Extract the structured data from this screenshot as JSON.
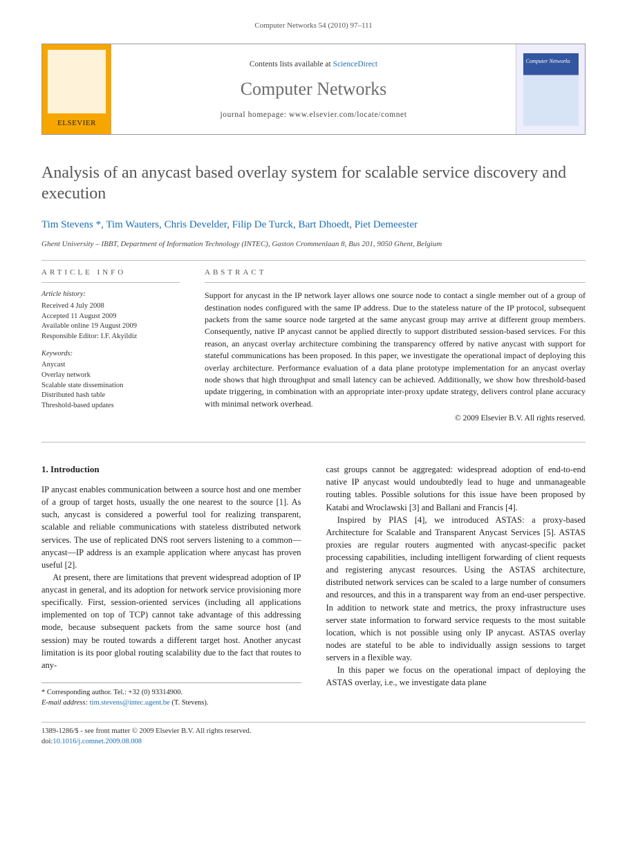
{
  "citation": "Computer Networks 54 (2010) 97–111",
  "header": {
    "contents_prefix": "Contents lists available at ",
    "contents_link": "ScienceDirect",
    "journal": "Computer Networks",
    "homepage_label": "journal homepage: www.elsevier.com/locate/comnet",
    "publisher_word": "ELSEVIER"
  },
  "title": "Analysis of an anycast based overlay system for scalable service discovery and execution",
  "authors_line": "Tim Stevens *, Tim Wauters, Chris Develder, Filip De Turck, Bart Dhoedt, Piet Demeester",
  "affiliation": "Ghent University – IBBT, Department of Information Technology (INTEC), Gaston Crommenlaan 8, Bus 201, 9050 Ghent, Belgium",
  "article_info": {
    "head": "article info",
    "history_label": "Article history:",
    "history": [
      "Received 4 July 2008",
      "Accepted 11 August 2009",
      "Available online 19 August 2009",
      "Responsible Editor: I.F. Akyildiz"
    ],
    "keywords_label": "Keywords:",
    "keywords": [
      "Anycast",
      "Overlay network",
      "Scalable state dissemination",
      "Distributed hash table",
      "Threshold-based updates"
    ]
  },
  "abstract": {
    "head": "abstract",
    "text": "Support for anycast in the IP network layer allows one source node to contact a single member out of a group of destination nodes configured with the same IP address. Due to the stateless nature of the IP protocol, subsequent packets from the same source node targeted at the same anycast group may arrive at different group members. Consequently, native IP anycast cannot be applied directly to support distributed session-based services. For this reason, an anycast overlay architecture combining the transparency offered by native anycast with support for stateful communications has been proposed. In this paper, we investigate the operational impact of deploying this overlay architecture. Performance evaluation of a data plane prototype implementation for an anycast overlay node shows that high throughput and small latency can be achieved. Additionally, we show how threshold-based update triggering, in combination with an appropriate inter-proxy update strategy, delivers control plane accuracy with minimal network overhead.",
    "copyright": "© 2009 Elsevier B.V. All rights reserved."
  },
  "intro": {
    "heading": "1. Introduction",
    "p1": "IP anycast enables communication between a source host and one member of a group of target hosts, usually the one nearest to the source [1]. As such, anycast is considered a powerful tool for realizing transparent, scalable and reliable communications with stateless distributed network services. The use of replicated DNS root servers listening to a common—anycast—IP address is an example application where anycast has proven useful [2].",
    "p2": "At present, there are limitations that prevent widespread adoption of IP anycast in general, and its adoption for network service provisioning more specifically. First, session-oriented services (including all applications implemented on top of TCP) cannot take advantage of this addressing mode, because subsequent packets from the same source host (and session) may be routed towards a different target host. Another anycast limitation is its poor global routing scalability due to the fact that routes to any-",
    "p3": "cast groups cannot be aggregated: widespread adoption of end-to-end native IP anycast would undoubtedly lead to huge and unmanageable routing tables. Possible solutions for this issue have been proposed by Katabi and Wroclawski [3] and Ballani and Francis [4].",
    "p4": "Inspired by PIAS [4], we introduced ASTAS: a proxy-based Architecture for Scalable and Transparent Anycast Services [5]. ASTAS proxies are regular routers augmented with anycast-specific packet processing capabilities, including intelligent forwarding of client requests and registering anycast resources. Using the ASTAS architecture, distributed network services can be scaled to a large number of consumers and resources, and this in a transparent way from an end-user perspective. In addition to network state and metrics, the proxy infrastructure uses server state information to forward service requests to the most suitable location, which is not possible using only IP anycast. ASTAS overlay nodes are stateful to be able to individually assign sessions to target servers in a flexible way.",
    "p5": "In this paper we focus on the operational impact of deploying the ASTAS overlay, i.e., we investigate data plane"
  },
  "corresponding": {
    "label": "* Corresponding author. Tel.: +32 (0) 93314900.",
    "email_label": "E-mail address:",
    "email": "tim.stevens@intec.ugent.be",
    "email_suffix": "(T. Stevens)."
  },
  "footer": {
    "line1": "1389-1286/$ - see front matter © 2009 Elsevier B.V. All rights reserved.",
    "doi_label": "doi:",
    "doi": "10.1016/j.comnet.2009.08.008"
  }
}
